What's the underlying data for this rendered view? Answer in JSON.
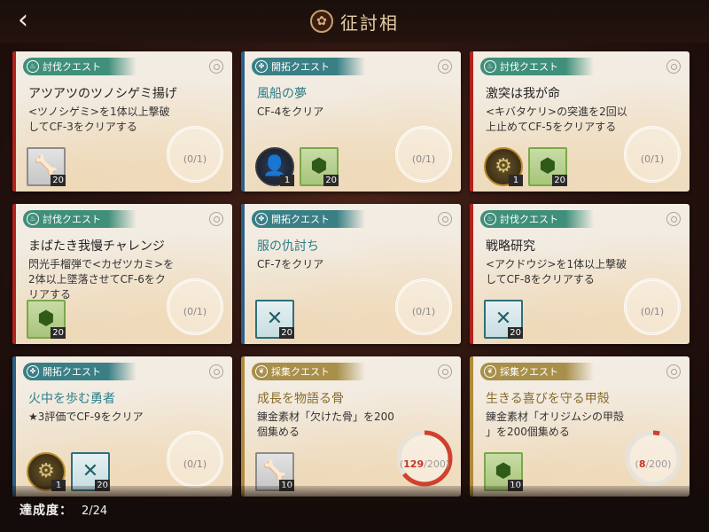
{
  "header": {
    "back_icon": "chevron-left-icon",
    "title": "征討相"
  },
  "colors": {
    "accent_red": "#b3221c",
    "accent_blue": "#2a5f8a",
    "accent_gold": "#b08a3a",
    "tag_green": "#3f8f7a",
    "tag_blue": "#3a7f86",
    "tag_gold": "#a88f4a"
  },
  "quests": [
    {
      "tag": "討伐クエスト",
      "title": "アツアツのツノシゲミ揚げ",
      "desc": "<ツノシゲミ>を1体以上撃破\nしてCF-3をクリアする",
      "progress": "(0/1)",
      "rewards": [
        {
          "icon": "bone-icon",
          "count": "20"
        }
      ]
    },
    {
      "tag": "開拓クエスト",
      "title": "風船の夢",
      "desc": "CF-4をクリア",
      "progress": "(0/1)",
      "rewards": [
        {
          "icon": "character-portrait-icon",
          "count": "1"
        },
        {
          "icon": "hexagon-crystal-icon",
          "count": "20"
        }
      ]
    },
    {
      "tag": "討伐クエスト",
      "title": "激突は我が命",
      "desc": "<キバタケリ>の突進を2回以\n上止めてCF-5をクリアする",
      "progress": "(0/1)",
      "rewards": [
        {
          "icon": "armor-gear-icon",
          "count": "1"
        },
        {
          "icon": "hexagon-crystal-icon",
          "count": "20"
        }
      ]
    },
    {
      "tag": "討伐クエスト",
      "title": "まばたき我慢チャレンジ",
      "desc": "閃光手榴弾で<カゼツカミ>を\n2体以上墜落させてCF-6をク\nリアする",
      "progress": "(0/1)",
      "rewards": [
        {
          "icon": "hexagon-crystal-icon",
          "count": "20"
        }
      ]
    },
    {
      "tag": "開拓クエスト",
      "title": "服の仇討ち",
      "desc": "CF-7をクリア",
      "progress": "(0/1)",
      "rewards": [
        {
          "icon": "teal-fang-icon",
          "count": "20"
        }
      ]
    },
    {
      "tag": "討伐クエスト",
      "title": "戦略研究",
      "desc": "<アクドウジ>を1体以上撃破\nしてCF-8をクリアする",
      "progress": "(0/1)",
      "rewards": [
        {
          "icon": "teal-fang-icon",
          "count": "20"
        }
      ]
    },
    {
      "tag": "開拓クエスト",
      "title": "火中を歩む勇者",
      "desc": "★3評価でCF-9をクリア",
      "progress": "(0/1)",
      "rewards": [
        {
          "icon": "armor-gear-icon",
          "count": "1"
        },
        {
          "icon": "teal-fang-icon",
          "count": "20"
        }
      ]
    },
    {
      "tag": "採集クエスト",
      "title": "成長を物語る骨",
      "desc": "錬金素材「欠けた骨」を200\n個集める",
      "progress_current": "129",
      "progress_total": "/200)",
      "progress_open": "(",
      "progress_fraction": 0.645,
      "rewards": [
        {
          "icon": "bone-icon",
          "count": "10"
        }
      ]
    },
    {
      "tag": "採集クエスト",
      "title": "生きる喜びを守る甲殻",
      "desc": "錬金素材「オリジムシの甲殻\n」を200個集める",
      "progress_current": "8",
      "progress_total": "/200)",
      "progress_open": "(",
      "progress_fraction": 0.04,
      "rewards": [
        {
          "icon": "hexagon-crystal-icon",
          "count": "10"
        }
      ]
    }
  ],
  "footer": {
    "label": "達成度：",
    "value": "2/24"
  }
}
